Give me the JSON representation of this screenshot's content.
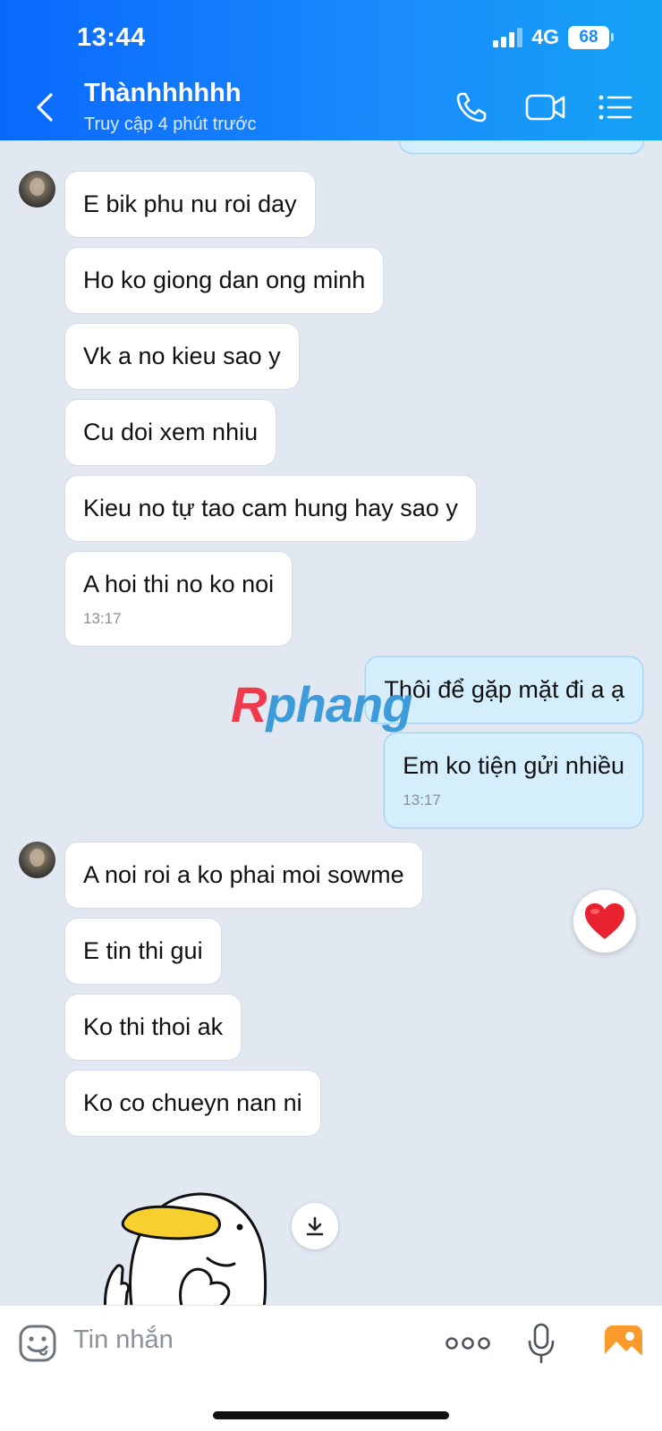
{
  "status_bar": {
    "time": "13:44",
    "network": "4G",
    "battery": "68"
  },
  "header": {
    "contact_name": "Thànhhhhhh",
    "last_seen": "Truy cập 4 phút trước"
  },
  "messages": [
    {
      "direction": "in",
      "text": "E bik phu nu roi day"
    },
    {
      "direction": "in",
      "text": "Ho ko giong dan ong minh"
    },
    {
      "direction": "in",
      "text": "Vk a no kieu sao y"
    },
    {
      "direction": "in",
      "text": "Cu doi xem nhiu"
    },
    {
      "direction": "in",
      "text": "Kieu no tự tao cam hung hay sao y"
    },
    {
      "direction": "in",
      "text": "A hoi thi no ko noi",
      "time": "13:17"
    },
    {
      "direction": "out",
      "text": "Thôi để gặp mặt đi a ạ"
    },
    {
      "direction": "out",
      "text": "Em ko tiện gửi nhiều",
      "time": "13:17"
    },
    {
      "direction": "in",
      "text": "A noi roi a ko phai moi sowme"
    },
    {
      "direction": "in",
      "text": "E tin thi gui"
    },
    {
      "direction": "in",
      "text": "Ko thi thoi ak"
    },
    {
      "direction": "in",
      "text": "Ko co chueyn nan ni"
    }
  ],
  "watermark": {
    "first": "R",
    "rest": "phang"
  },
  "reaction": {
    "icon": "heart-icon",
    "color": "#e8232f"
  },
  "composer": {
    "placeholder": "Tin nhắn"
  },
  "colors": {
    "header_start": "#0a68ff",
    "header_end": "#14a3f5",
    "chat_bg": "#e2e8f1",
    "outgoing_bubble": "#d4eefc"
  }
}
